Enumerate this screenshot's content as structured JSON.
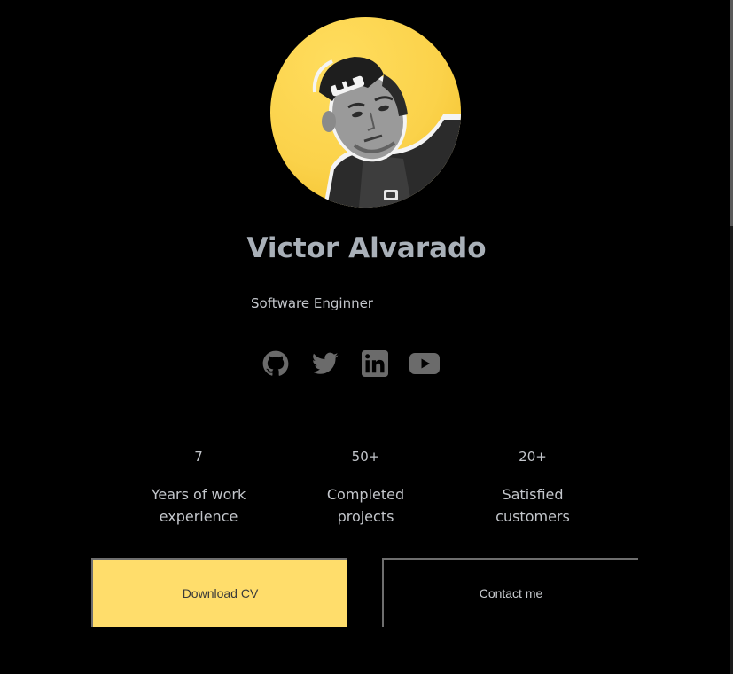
{
  "profile": {
    "name": "Victor Alvarado",
    "role": "Software Enginner"
  },
  "socials": [
    {
      "name": "github-icon"
    },
    {
      "name": "twitter-icon"
    },
    {
      "name": "linkedin-icon"
    },
    {
      "name": "youtube-icon"
    }
  ],
  "stats": [
    {
      "value": "7",
      "label_line1": "Years of work",
      "label_line2": "experience"
    },
    {
      "value": "50+",
      "label_line1": "Completed",
      "label_line2": "projects"
    },
    {
      "value": "20+",
      "label_line1": "Satisfied",
      "label_line2": "customers"
    }
  ],
  "buttons": {
    "download_label": "Download CV",
    "contact_label": "Contact me"
  },
  "colors": {
    "background": "#000000",
    "accent": "#ffdd6b",
    "text": "#c3c6cb",
    "icon": "#6b6b6b"
  }
}
